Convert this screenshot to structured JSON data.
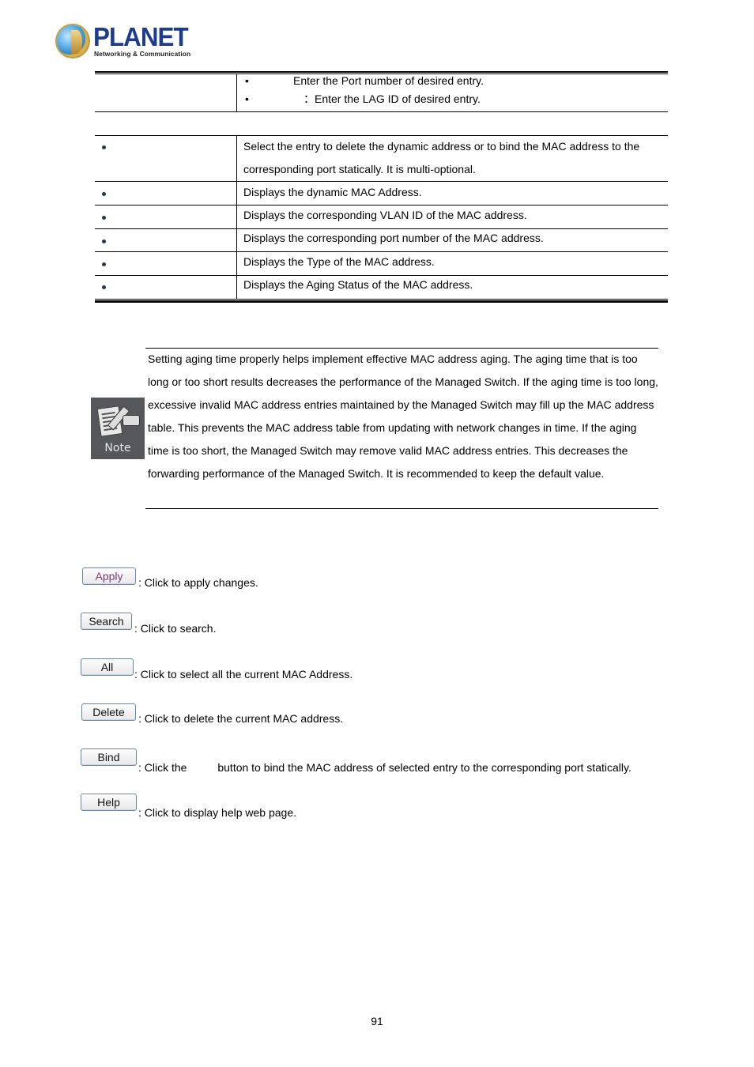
{
  "header": {
    "logo_word": "PLANET",
    "logo_tagline": "Networking & Communication"
  },
  "top_table": {
    "rows": [
      {
        "items": [
          {
            "label": "",
            "text": "Enter the Port number of desired entry."
          },
          {
            "label": "",
            "text": "：Enter the LAG ID of desired entry."
          }
        ]
      }
    ]
  },
  "field_table": {
    "rows": [
      {
        "name": "",
        "lines": [
          "Select the entry to delete the dynamic address or to bind the MAC address to the",
          "corresponding port statically. It is multi-optional."
        ]
      },
      {
        "name": "",
        "lines": [
          "Displays the dynamic MAC Address."
        ]
      },
      {
        "name": "",
        "lines": [
          "Displays the corresponding VLAN ID of the MAC address."
        ]
      },
      {
        "name": "",
        "lines": [
          "Displays the corresponding port number of the MAC address."
        ]
      },
      {
        "name": "",
        "lines": [
          "Displays the Type of the MAC address."
        ]
      },
      {
        "name": "",
        "lines": [
          "Displays the Aging Status of the MAC address."
        ]
      }
    ]
  },
  "note": {
    "icon_label": "Note",
    "text": "Setting aging time properly helps implement effective MAC address aging. The aging time that is too long or too short results decreases the performance of the Managed Switch. If the aging time is too long, excessive invalid MAC address entries maintained by the Managed Switch may fill up the MAC address table. This prevents the MAC address table from updating with network changes in time. If the aging time is too short, the Managed Switch may remove valid MAC address entries. This decreases the forwarding performance of the Managed Switch. It is recommended to keep the default value."
  },
  "buttons": [
    {
      "label": "Apply",
      "desc": ": Click to apply changes."
    },
    {
      "label": "Search",
      "desc": ": Click to search."
    },
    {
      "label": "All",
      "desc": ": Click to select all the current MAC Address."
    },
    {
      "label": "Delete",
      "desc": ": Click to delete the current MAC address."
    },
    {
      "label": "Bind",
      "desc": ": Click the          button to bind the MAC address of selected entry to the corresponding port statically."
    },
    {
      "label": "Help",
      "desc": ": Click to display help web page."
    }
  ],
  "footer": {
    "page_number": "91"
  }
}
